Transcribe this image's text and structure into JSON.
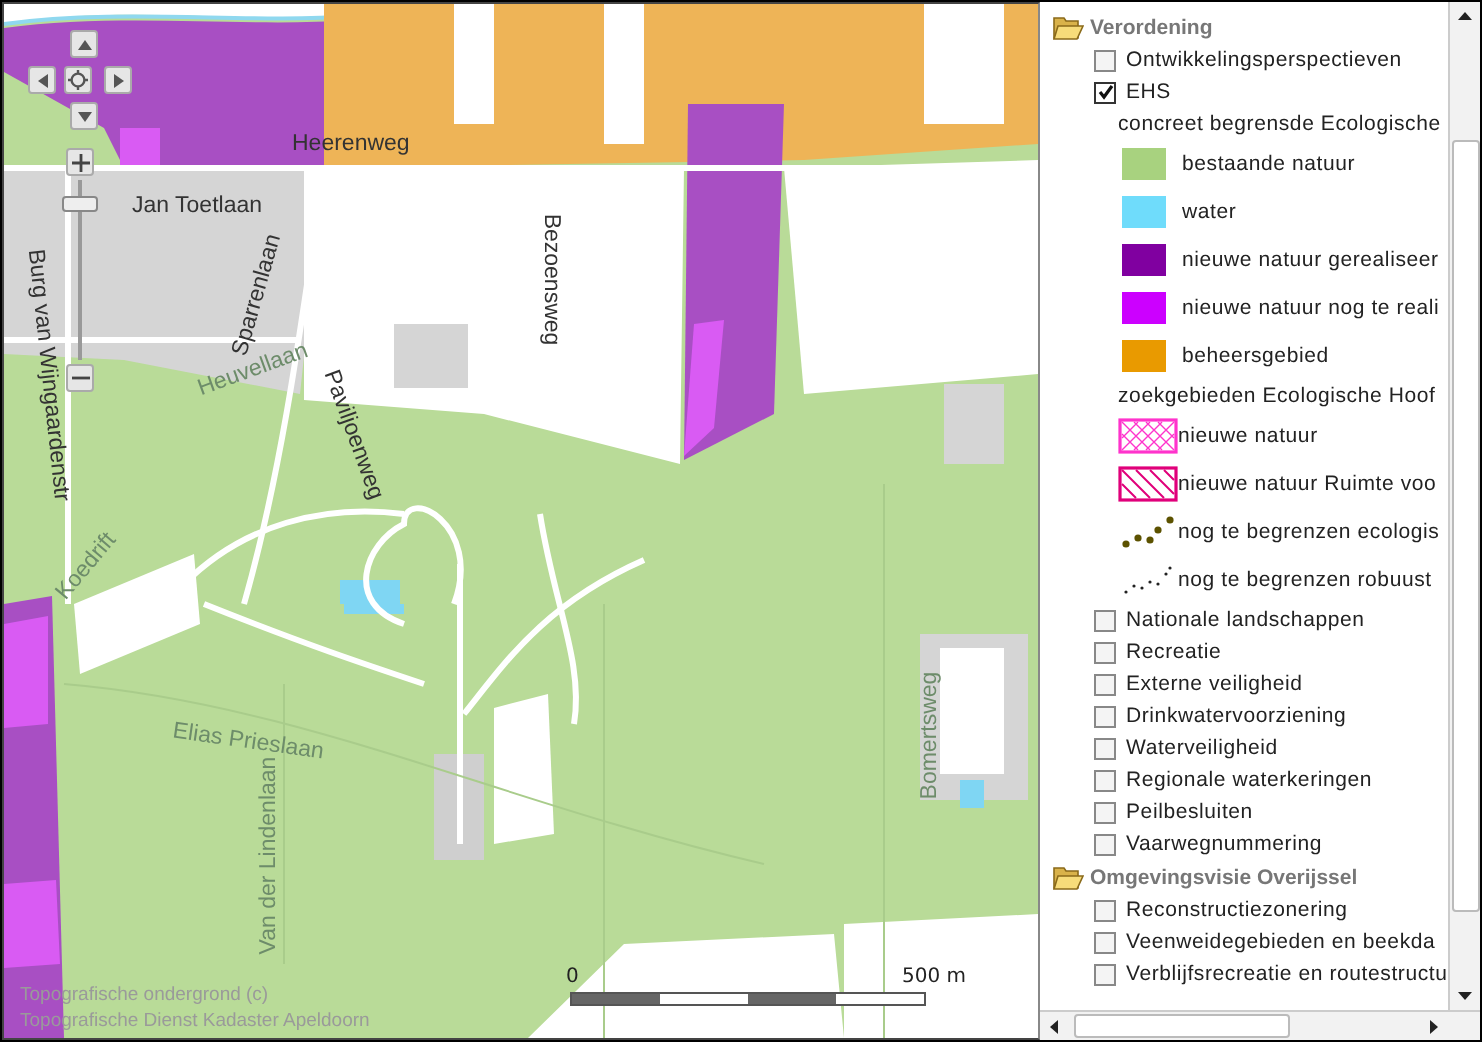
{
  "map": {
    "labels": [
      {
        "text": "Heerenweg",
        "kind": "street"
      },
      {
        "text": "Jan Toetlaan",
        "kind": "street"
      },
      {
        "text": "Sparrenlaan",
        "kind": "street"
      },
      {
        "text": "Burg van Wijngaardenstr",
        "kind": "street"
      },
      {
        "text": "Heuvellaan",
        "kind": "forest"
      },
      {
        "text": "Paviljoenweg",
        "kind": "street"
      },
      {
        "text": "Bezoensweg",
        "kind": "street"
      },
      {
        "text": "Koedrift",
        "kind": "forest"
      },
      {
        "text": "Elias Prieslaan",
        "kind": "forest"
      },
      {
        "text": "Van der Lindenlaan",
        "kind": "forest"
      },
      {
        "text": "Bomertsweg",
        "kind": "forest"
      }
    ],
    "zoom": {
      "level": 0.9
    },
    "scale": {
      "start": "0",
      "end": "500 m"
    },
    "copyright": [
      "Topografische ondergrond (c)",
      "Topografische Dienst Kadaster Apeldoorn"
    ]
  },
  "legend": {
    "sections": [
      {
        "title": "Verordening",
        "items": [
          {
            "kind": "checkbox",
            "label": "Ontwikkelingsperspectieven",
            "checked": false
          },
          {
            "kind": "checkbox",
            "label": "EHS",
            "checked": true
          },
          {
            "kind": "heading",
            "label": "concreet begrensde Ecologische"
          },
          {
            "kind": "swatch",
            "label": "bestaande natuur",
            "color": "#a8d27f"
          },
          {
            "kind": "swatch",
            "label": "water",
            "color": "#6fdcfb"
          },
          {
            "kind": "swatch",
            "label": "nieuwe natuur gerealiseer",
            "color": "#8000a0"
          },
          {
            "kind": "swatch",
            "label": "nieuwe natuur nog te reali",
            "color": "#cc00ff"
          },
          {
            "kind": "swatch",
            "label": "beheersgebied",
            "color": "#e99a00"
          },
          {
            "kind": "heading",
            "label": "zoekgebieden Ecologische Hoof"
          },
          {
            "kind": "crosshatch",
            "label": "nieuwe natuur",
            "color": "#ff33cc"
          },
          {
            "kind": "diagonalhatch",
            "label": "nieuwe natuur Ruimte voo",
            "color": "#e0007a"
          },
          {
            "kind": "largedots",
            "label": "nog te begrenzen ecologis",
            "color": "#5c5200"
          },
          {
            "kind": "smalldots",
            "label": "nog te begrenzen robuust",
            "color": "#222222"
          },
          {
            "kind": "checkbox",
            "label": "Nationale landschappen",
            "checked": false
          },
          {
            "kind": "checkbox",
            "label": "Recreatie",
            "checked": false
          },
          {
            "kind": "checkbox",
            "label": "Externe veiligheid",
            "checked": false
          },
          {
            "kind": "checkbox",
            "label": "Drinkwatervoorziening",
            "checked": false
          },
          {
            "kind": "checkbox",
            "label": "Waterveiligheid",
            "checked": false
          },
          {
            "kind": "checkbox",
            "label": "Regionale waterkeringen",
            "checked": false
          },
          {
            "kind": "checkbox",
            "label": "Peilbesluiten",
            "checked": false
          },
          {
            "kind": "checkbox",
            "label": "Vaarwegnummering",
            "checked": false
          }
        ]
      },
      {
        "title": "Omgevingsvisie Overijssel",
        "items": [
          {
            "kind": "checkbox",
            "label": "Reconstructiezonering",
            "checked": false
          },
          {
            "kind": "checkbox",
            "label": "Veenweidegebieden en beekda",
            "checked": false
          },
          {
            "kind": "checkbox",
            "label": "Verblijfsrecreatie en routestructu",
            "checked": false
          }
        ]
      }
    ]
  }
}
